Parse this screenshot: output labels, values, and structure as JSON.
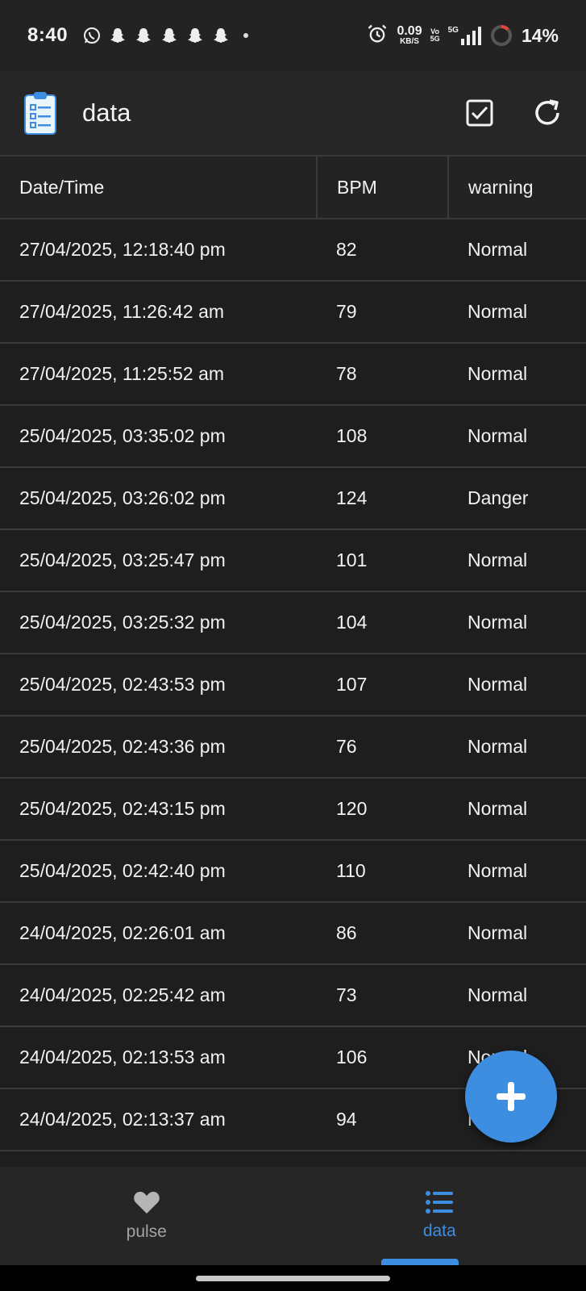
{
  "status_bar": {
    "time": "8:40",
    "net_speed_value": "0.09",
    "net_speed_unit": "KB/S",
    "volte_top": "Vo",
    "volte_bottom": "5G",
    "network": "5G",
    "battery": "14%",
    "notification_icons": [
      "whatsapp-icon",
      "snapchat-icon",
      "snapchat-icon",
      "snapchat-icon",
      "snapchat-icon",
      "snapchat-icon"
    ]
  },
  "app_bar": {
    "title": "data",
    "icon": "clipboard-list-icon",
    "actions": [
      "checkbox-icon",
      "refresh-icon"
    ]
  },
  "table": {
    "headers": [
      "Date/Time",
      "BPM",
      "warning"
    ],
    "rows": [
      [
        "27/04/2025, 12:18:40 pm",
        "82",
        "Normal"
      ],
      [
        "27/04/2025, 11:26:42 am",
        "79",
        "Normal"
      ],
      [
        "27/04/2025, 11:25:52 am",
        "78",
        "Normal"
      ],
      [
        "25/04/2025, 03:35:02 pm",
        "108",
        "Normal"
      ],
      [
        "25/04/2025, 03:26:02 pm",
        "124",
        "Danger"
      ],
      [
        "25/04/2025, 03:25:47 pm",
        "101",
        "Normal"
      ],
      [
        "25/04/2025, 03:25:32 pm",
        "104",
        "Normal"
      ],
      [
        "25/04/2025, 02:43:53 pm",
        "107",
        "Normal"
      ],
      [
        "25/04/2025, 02:43:36 pm",
        "76",
        "Normal"
      ],
      [
        "25/04/2025, 02:43:15 pm",
        "120",
        "Normal"
      ],
      [
        "25/04/2025, 02:42:40 pm",
        "110",
        "Normal"
      ],
      [
        "24/04/2025, 02:26:01 am",
        "86",
        "Normal"
      ],
      [
        "24/04/2025, 02:25:42 am",
        "73",
        "Normal"
      ],
      [
        "24/04/2025, 02:13:53 am",
        "106",
        "Normal"
      ],
      [
        "24/04/2025, 02:13:37 am",
        "94",
        "Normal"
      ]
    ]
  },
  "fab": {
    "icon": "plus-icon"
  },
  "bottom_nav": {
    "items": [
      {
        "label": "pulse",
        "icon": "heart-icon",
        "active": false
      },
      {
        "label": "data",
        "icon": "list-icon",
        "active": true
      }
    ]
  },
  "colors": {
    "accent": "#3d8ee0",
    "background": "#1e1e1e",
    "bar": "#262626",
    "divider": "#3a3a3a"
  }
}
